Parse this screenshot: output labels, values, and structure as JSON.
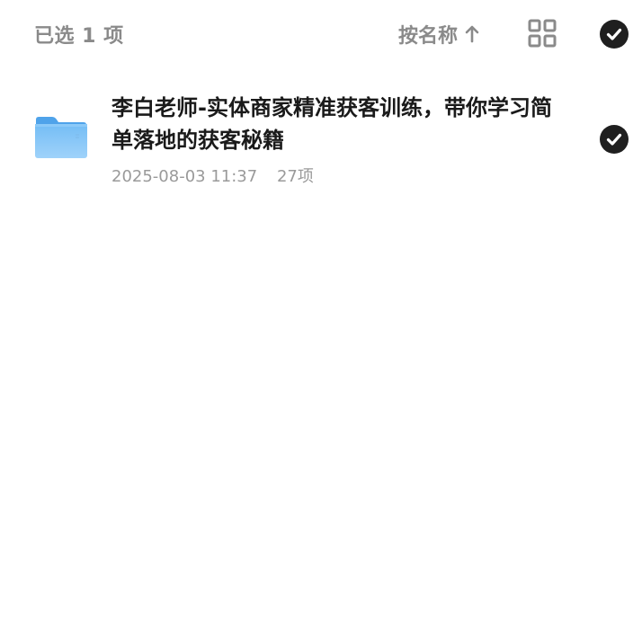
{
  "header": {
    "selected_label": "已选 1 项",
    "sort_label": "按名称",
    "sort_direction_icon": "arrow-up-icon",
    "view_toggle_icon": "grid-view-icon",
    "select_all_icon": "check-circle-icon"
  },
  "files": [
    {
      "icon": "folder-icon",
      "name": "李白老师-实体商家精准获客训练，带你学习简单落地的获客秘籍",
      "date": "2025-08-03 11:37",
      "count": "27项",
      "selected": true
    }
  ],
  "colors": {
    "check_bg": "#1f1f1f",
    "muted_text": "#8a8a8a",
    "folder_blue": "#5aaef0"
  }
}
